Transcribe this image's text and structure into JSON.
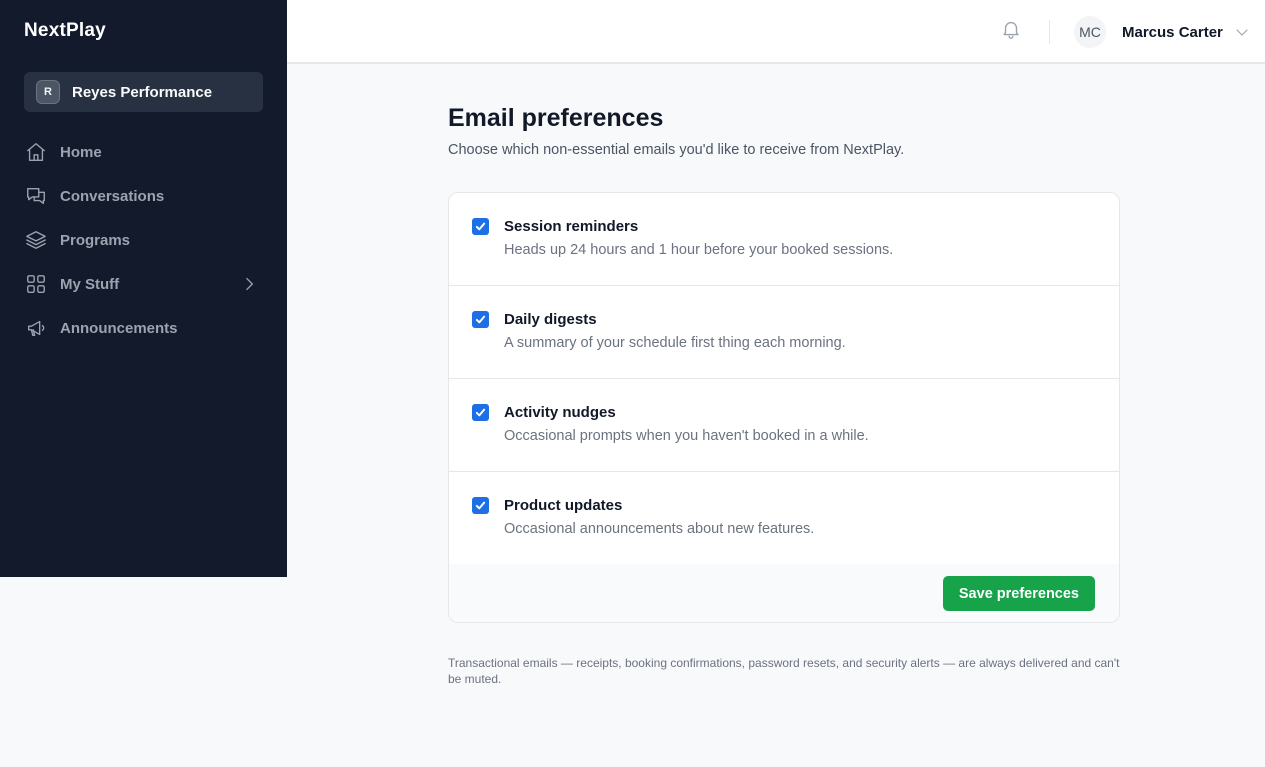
{
  "sidebar": {
    "brand": "NextPlay",
    "org": {
      "initial": "R",
      "name": "Reyes Performance"
    },
    "items": [
      {
        "label": "Home",
        "icon": "home-icon"
      },
      {
        "label": "Conversations",
        "icon": "chat-bubbles-icon"
      },
      {
        "label": "Programs",
        "icon": "layers-icon"
      },
      {
        "label": "My Stuff",
        "icon": "grid-icon"
      },
      {
        "label": "Announcements",
        "icon": "megaphone-icon"
      }
    ]
  },
  "header": {
    "user_initials": "MC",
    "user_name": "Marcus Carter"
  },
  "main": {
    "title": "Email preferences",
    "subtitle": "Choose which non-essential emails you'd like to receive from NextPlay.",
    "preferences": [
      {
        "title": "Session reminders",
        "description": "Heads up 24 hours and 1 hour before your booked sessions.",
        "checked": true
      },
      {
        "title": "Daily digests",
        "description": "A summary of your schedule first thing each morning.",
        "checked": true
      },
      {
        "title": "Activity nudges",
        "description": "Occasional prompts when you haven't booked in a while.",
        "checked": true
      },
      {
        "title": "Product updates",
        "description": "Occasional announcements about new features.",
        "checked": true
      }
    ],
    "save_label": "Save preferences",
    "footnote": "Transactional emails — receipts, booking confirmations, password resets, and security alerts — are always delivered and can't be muted."
  },
  "colors": {
    "sidebar_bg": "#121a2c",
    "checkbox": "#1d6fe6",
    "save_button": "#16a34a"
  }
}
